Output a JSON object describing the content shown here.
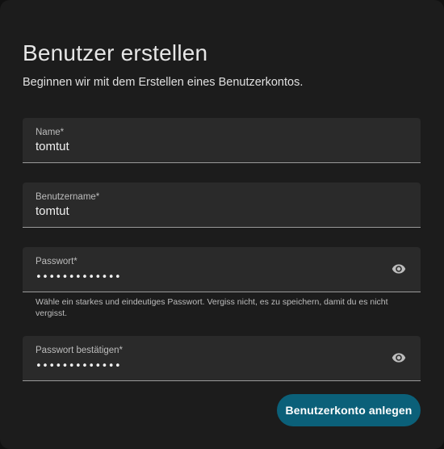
{
  "header": {
    "title": "Benutzer erstellen",
    "subtitle": "Beginnen wir mit dem Erstellen eines Benutzerkontos."
  },
  "form": {
    "name": {
      "label": "Name*",
      "value": "tomtut"
    },
    "username": {
      "label": "Benutzername*",
      "value": "tomtut"
    },
    "password": {
      "label": "Passwort*",
      "masked_value": "•••••••••••••",
      "helper": "Wähle ein starkes und eindeutiges Passwort. Vergiss nicht, es zu speichern, damit du es nicht vergisst.",
      "icon": "eye-icon"
    },
    "password_confirm": {
      "label": "Passwort bestätigen*",
      "masked_value": "•••••••••••••",
      "icon": "eye-icon"
    }
  },
  "actions": {
    "submit_label": "Benutzerkonto anlegen"
  },
  "colors": {
    "background": "#1c1c1c",
    "field_background": "#2a2a2a",
    "primary_button": "#0b6079",
    "text": "#e6e6e6"
  }
}
